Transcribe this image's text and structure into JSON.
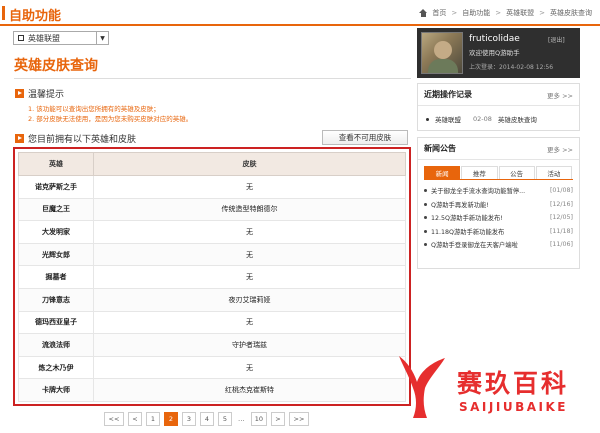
{
  "header": {
    "title": "自助功能",
    "breadcrumb": [
      "首页",
      "自助功能",
      "英雄联盟",
      "英雄皮肤查询"
    ],
    "breadcrumb_sep": ">"
  },
  "game_select": {
    "value": "英雄联盟",
    "arrow": "▼"
  },
  "page_title": "英雄皮肤查询",
  "tips": {
    "title": "温馨提示",
    "lines": [
      "1. 该功能可以查询出您所拥有的英雄及皮肤；",
      "2. 部分皮肤无法使用，是因为您未购买皮肤对应的英雄。"
    ]
  },
  "owned_section": {
    "title": "您目前拥有以下英雄和皮肤",
    "unusable_button": "查看不可用皮肤"
  },
  "table": {
    "headers": [
      "英雄",
      "皮肤"
    ],
    "rows": [
      {
        "hero": "诺克萨斯之手",
        "skin": "无"
      },
      {
        "hero": "巨魔之王",
        "skin": "传统造型特朗德尔"
      },
      {
        "hero": "大发明家",
        "skin": "无"
      },
      {
        "hero": "光辉女郎",
        "skin": "无"
      },
      {
        "hero": "掘墓者",
        "skin": "无"
      },
      {
        "hero": "刀锋意志",
        "skin": "夜刃艾瑞莉娅"
      },
      {
        "hero": "德玛西亚皇子",
        "skin": "无"
      },
      {
        "hero": "流浪法师",
        "skin": "守护者瑞兹"
      },
      {
        "hero": "炼之木乃伊",
        "skin": "无"
      },
      {
        "hero": "卡牌大师",
        "skin": "红桃杰克崔斯特"
      }
    ]
  },
  "pagination": {
    "first": "<<",
    "prev": "<",
    "pages": [
      "1",
      "2",
      "3",
      "4",
      "5"
    ],
    "active": "2",
    "ellipsis": "...",
    "last_page": "10",
    "next": ">",
    "last": ">>"
  },
  "profile": {
    "username": "fruticolidae",
    "logout": "[退出]",
    "welcome": "欢迎使用Q游助手",
    "last_login": "上次登录：2014-02-08 12:56"
  },
  "records": {
    "title": "近期操作记录",
    "more": "更多 >>",
    "items": [
      {
        "name": "英雄联盟",
        "date": "02-08",
        "action": "英雄皮肤查询"
      }
    ]
  },
  "news": {
    "title": "新闻公告",
    "more": "更多 >>",
    "tabs": [
      "新闻",
      "推荐",
      "公告",
      "活动"
    ],
    "active_tab": "新闻",
    "items": [
      {
        "title": "关于御龙全手流水查询功能暂停...",
        "date": "[01/08]"
      },
      {
        "title": "Q游助手再发新功能!",
        "date": "[12/16]"
      },
      {
        "title": "12.5Q游助手新功能发布!",
        "date": "[12/05]"
      },
      {
        "title": "11.18Q游助手新功能发布",
        "date": "[11/18]"
      },
      {
        "title": "Q游助手登录御龙在天客户端啦",
        "date": "[11/06]"
      }
    ]
  },
  "watermark": {
    "cn": "赛玖百科",
    "en": "SAIJIUBAIKE"
  },
  "colors": {
    "accent": "#e8650c",
    "highlight_border": "#cc2222",
    "watermark": "#e62e2e",
    "profile_bg": "#2f2f2f"
  }
}
